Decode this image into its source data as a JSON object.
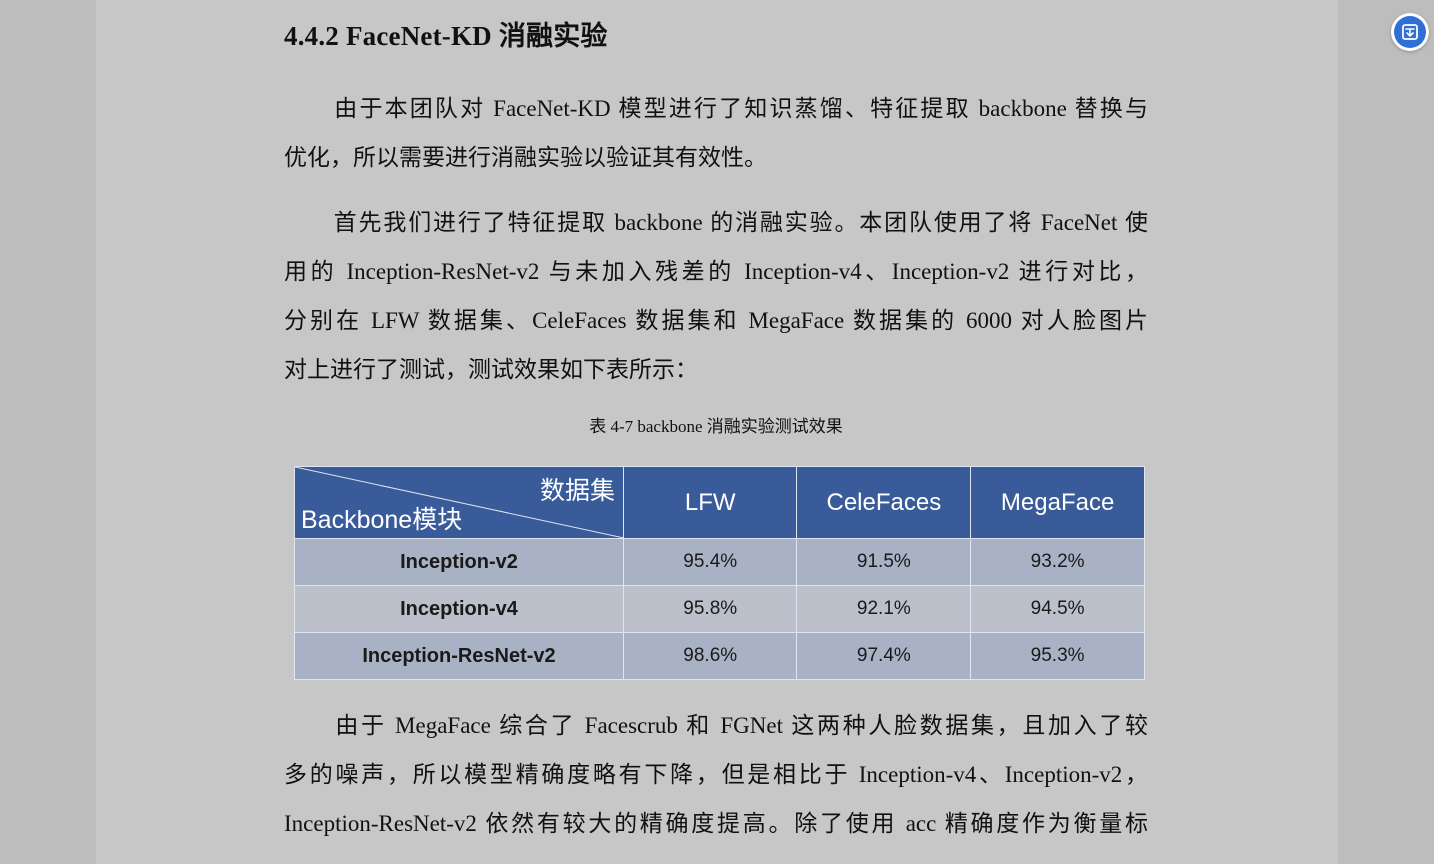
{
  "section": {
    "heading": "4.4.2 FaceNet-KD 消融实验"
  },
  "paragraph1": {
    "lines": [
      "　　由于本团队对 FaceNet-KD 模型进行了知识蒸馏、特征提取 backbone 替换与",
      "优化，所以需要进行消融实验以验证其有效性。"
    ]
  },
  "paragraph2": {
    "lines": [
      "　　首先我们进行了特征提取 backbone 的消融实验。本团队使用了将 FaceNet 使",
      "用的 Inception-ResNet-v2 与未加入残差的 Inception-v4、Inception-v2 进行对比，",
      "分别在 LFW 数据集、CeleFaces 数据集和 MegaFace 数据集的 6000 对人脸图片",
      "对上进行了测试，测试效果如下表所示："
    ]
  },
  "table": {
    "caption": "表 4-7 backbone 消融实验测试效果",
    "corner_top": "数据集",
    "corner_bottom": "Backbone模块",
    "columns": [
      "LFW",
      "CeleFaces",
      "MegaFace"
    ],
    "rows": [
      {
        "name": "Inception-v2",
        "values": [
          "95.4%",
          "91.5%",
          "93.2%"
        ]
      },
      {
        "name": "Inception-v4",
        "values": [
          "95.8%",
          "92.1%",
          "94.5%"
        ]
      },
      {
        "name": "Inception-ResNet-v2",
        "values": [
          "98.6%",
          "97.4%",
          "95.3%"
        ]
      }
    ]
  },
  "paragraph3": {
    "lines": [
      "　　由于 MegaFace 综合了 Facescrub 和 FGNet 这两种人脸数据集，且加入了较",
      "多的噪声，所以模型精确度略有下降，但是相比于 Inception-v4、Inception-v2，",
      "Inception-ResNet-v2 依然有较大的精确度提高。除了使用 acc 精确度作为衡量标"
    ]
  },
  "side_tool": {
    "icon": "translate-icon",
    "color": "#2f6fd8"
  }
}
